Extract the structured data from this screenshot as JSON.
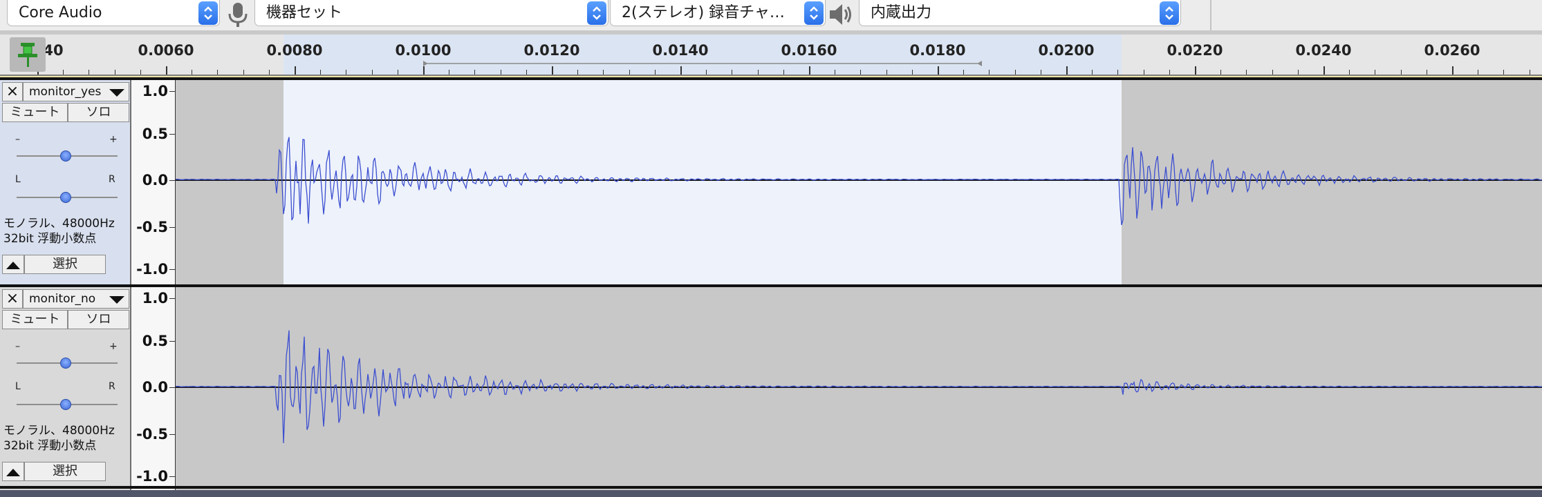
{
  "toolbar": {
    "host": "Core Audio",
    "input_device": "機器セット",
    "channels": "2(ステレオ) 録音チャ…",
    "output_device": "内蔵出力",
    "icons": [
      "microphone-icon",
      "speaker-icon"
    ]
  },
  "ruler": {
    "pin_overlap_label": "40",
    "labels": [
      "0.0060",
      "0.0080",
      "0.0100",
      "0.0120",
      "0.0140",
      "0.0160",
      "0.0180",
      "0.0200",
      "0.0220",
      "0.0240",
      "0.0260"
    ]
  },
  "tracks": [
    {
      "name": "monitor_yes",
      "mute_label": "ミュート",
      "solo_label": "ソロ",
      "gain_minus": "–",
      "gain_plus": "+",
      "pan_left": "L",
      "pan_right": "R",
      "format_line1": "モノラル、48000Hz",
      "format_line2": "32bit 浮動小数点",
      "select_label": "選択",
      "scale": [
        "1.0",
        "0.5",
        "0.0",
        "-0.5",
        "-1.0"
      ],
      "selected": true
    },
    {
      "name": "monitor_no",
      "mute_label": "ミュート",
      "solo_label": "ソロ",
      "gain_minus": "–",
      "gain_plus": "+",
      "pan_left": "L",
      "pan_right": "R",
      "format_line1": "モノラル、48000Hz",
      "format_line2": "32bit 浮動小数点",
      "select_label": "選択",
      "scale": [
        "1.0",
        "0.5",
        "0.0",
        "-0.5",
        "-1.0"
      ],
      "selected": false
    }
  ],
  "colors": {
    "waveform": "#3c4fd0",
    "selection": "#edf2fb",
    "accent": "#2a6fe8"
  }
}
